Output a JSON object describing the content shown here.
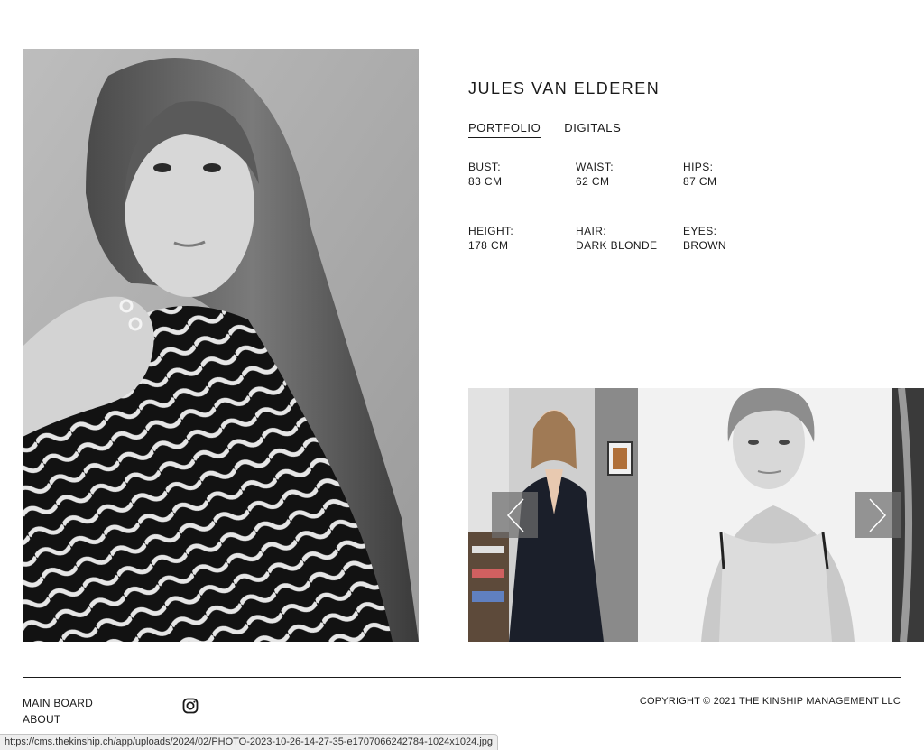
{
  "model": {
    "name": "JULES VAN ELDEREN"
  },
  "tabs": [
    {
      "label": "PORTFOLIO",
      "active": true
    },
    {
      "label": "DIGITALS",
      "active": false
    }
  ],
  "measurements": [
    {
      "label": "BUST:",
      "value": "83 CM"
    },
    {
      "label": "WAIST:",
      "value": "62 CM"
    },
    {
      "label": "HIPS:",
      "value": "87 CM"
    },
    {
      "label": "HEIGHT:",
      "value": "178 CM"
    },
    {
      "label": "HAIR:",
      "value": "DARK BLONDE"
    },
    {
      "label": "EYES:",
      "value": "BROWN"
    }
  ],
  "carousel": {
    "prev_icon": "chevron-left-icon",
    "next_icon": "chevron-right-icon"
  },
  "footer": {
    "links": [
      {
        "label": "MAIN BOARD"
      },
      {
        "label": "ABOUT"
      }
    ],
    "social_icon": "instagram-icon",
    "copyright": "COPYRIGHT © 2021 THE KINSHIP MANAGEMENT LLC"
  },
  "status_bar": {
    "url": "https://cms.thekinship.ch/app/uploads/2024/02/PHOTO-2023-10-26-14-27-35-e1707066242784-1024x1024.jpg"
  },
  "colors": {
    "text": "#1a1a1a",
    "background": "#ffffff",
    "arrow_overlay": "#6e6e6e"
  }
}
